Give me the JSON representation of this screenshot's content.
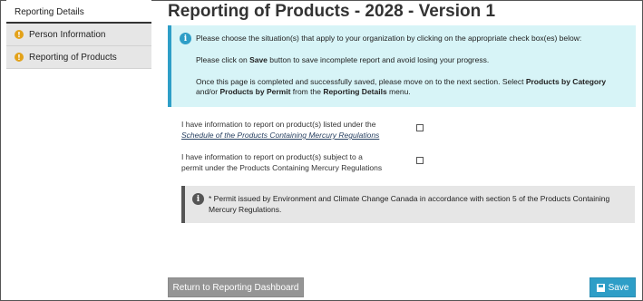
{
  "sidebar": {
    "header": "Reporting Details",
    "items": [
      {
        "label": "Person Information",
        "icon": "warning-icon"
      },
      {
        "label": "Reporting of Products",
        "icon": "warning-icon"
      }
    ]
  },
  "page": {
    "title": "Reporting of Products - 2028 - Version 1"
  },
  "info": {
    "icon": "info-icon",
    "line1": "Please choose the situation(s) that apply to your organization by clicking on the appropriate check box(es) below:",
    "line2_pre": "Please click on ",
    "line2_bold": "Save",
    "line2_post": " button to save incomplete report and avoid losing your progress.",
    "line3_pre": "Once this page is completed and successfully saved, please move on to the next section. Select ",
    "line3_bold1": "Products by Category",
    "line3_mid": "and/or ",
    "line3_bold2": "Products by Permit",
    "line3_mid2": " from the ",
    "line3_bold3": "Reporting Details",
    "line3_post": " menu."
  },
  "questions": [
    {
      "text": "I have information to report on product(s) listed under the",
      "link": "Schedule of the Products Containing Mercury Regulations",
      "checked": false
    },
    {
      "text1": "I have information to report on product(s) subject to a",
      "text2": "permit under the Products Containing Mercury Regulations",
      "checked": false
    }
  ],
  "note": {
    "icon": "info-icon",
    "line1": "* Permit issued by Environment and Climate Change Canada in accordance with section 5 of the Products Containing",
    "line2": "Mercury Regulations."
  },
  "buttons": {
    "return_label": "Return to Reporting Dashboard",
    "save_label": "Save"
  },
  "colors": {
    "accent": "#2e9ec7",
    "info_bg": "#d7f4f7",
    "warning": "#e3a21a",
    "button_gray": "#959595"
  }
}
